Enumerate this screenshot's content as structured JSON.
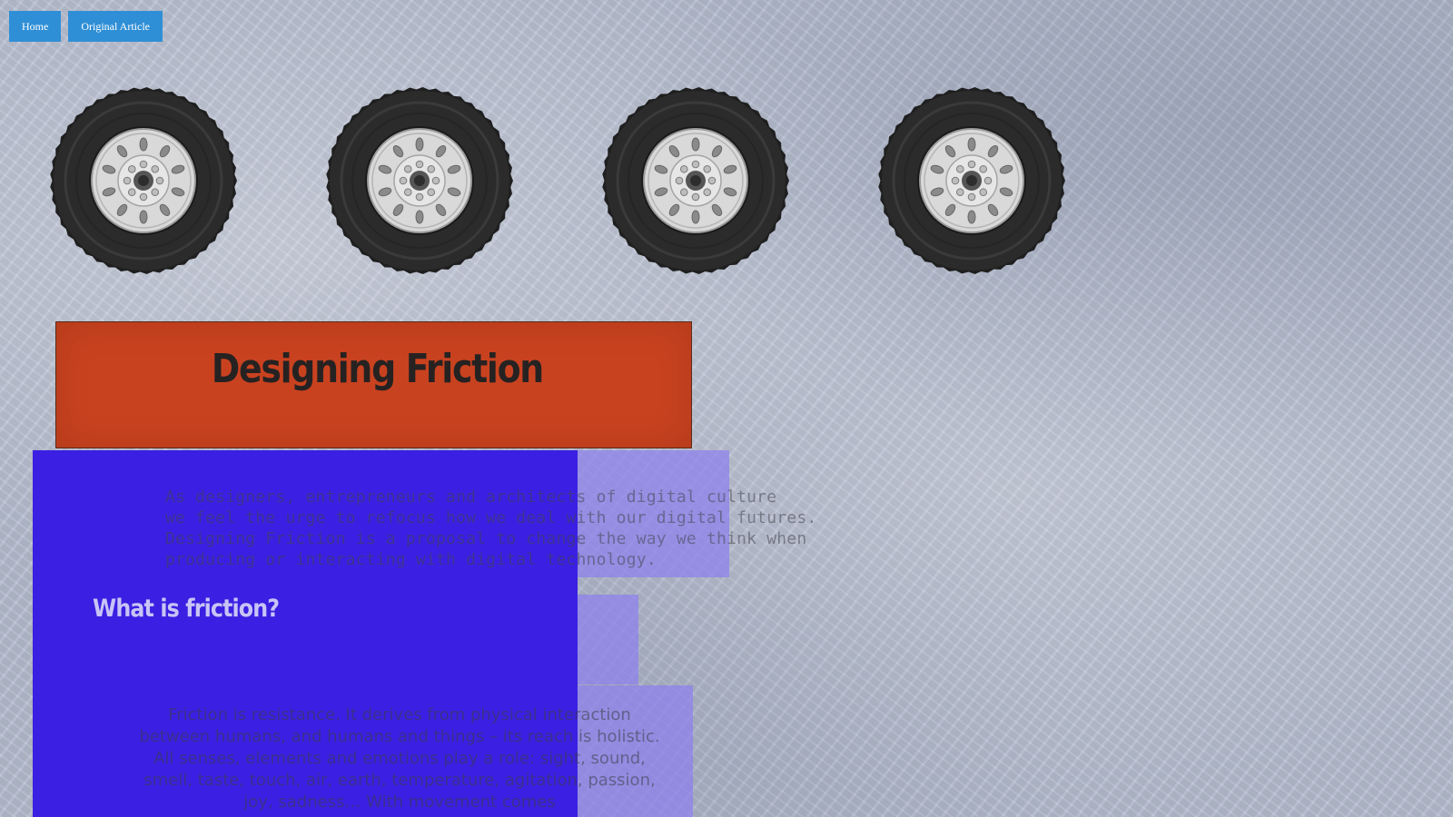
{
  "nav": {
    "home_label": "Home",
    "original_article_label": "Original Article"
  },
  "wheels": {
    "count": 4,
    "icon": "tire-wheel-icon"
  },
  "title": "Designing Friction",
  "intro_lines": [
    "As designers, entrepreneurs and architects of digital culture",
    "we feel the urge to refocus how we deal with our digital futures.",
    "Designing Friction is a proposal to change the way we think when",
    "producing or interacting with digital technology."
  ],
  "section": {
    "heading": "What is friction?",
    "body": "Friction is resistance. It derives from physical interaction between humans, and humans and things – its reach is holistic. All senses, elements and emotions play a role: sight, sound, smell, taste, touch, air, earth, temperature, agitation, passion, joy, sadness… With movement comes"
  },
  "colors": {
    "nav_button": "#2f8fd6",
    "title_box": "#c9421f",
    "blue_panel": "#3b1fe2",
    "lavender_panel": "#8c80ee",
    "paper": "#b9c1d3"
  }
}
